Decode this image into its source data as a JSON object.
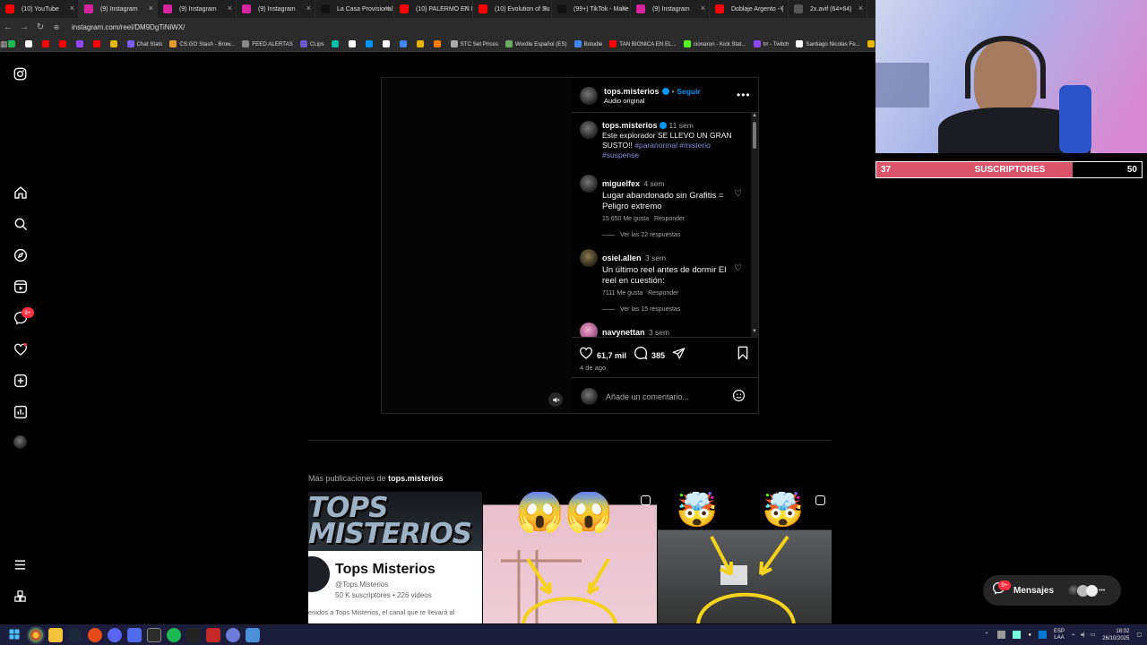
{
  "browser": {
    "tabs": [
      {
        "title": "(10) YouTube",
        "color": "#ff0000"
      },
      {
        "title": "(9) Instagram",
        "color": "#d6249f",
        "active": true
      },
      {
        "title": "(9) Instagram",
        "color": "#d6249f"
      },
      {
        "title": "(9) Instagram",
        "color": "#d6249f"
      },
      {
        "title": "La Casa Provisional",
        "color": "#111111"
      },
      {
        "title": "(10) PALERMO EN L",
        "color": "#ff0000"
      },
      {
        "title": "(10) Evolution of Su",
        "color": "#ff0000"
      },
      {
        "title": "(99+) TikTok - Make",
        "color": "#111111"
      },
      {
        "title": "(9) Instagram",
        "color": "#d6249f"
      },
      {
        "title": "Doblaje Argento - (",
        "color": "#ff0000"
      },
      {
        "title": "2x.avif (64×64)",
        "color": "#555555"
      }
    ],
    "url": "instagram.com/reel/DM9DgTiNiWX/",
    "bookmarks": [
      {
        "label": "",
        "color": "#1db954"
      },
      {
        "label": "",
        "color": "#ffffff"
      },
      {
        "label": "",
        "color": "#ff0000"
      },
      {
        "label": "",
        "color": "#ff0000"
      },
      {
        "label": "",
        "color": "#9146ff"
      },
      {
        "label": "",
        "color": "#ff0000"
      },
      {
        "label": "",
        "color": "#e8b500"
      },
      {
        "label": "Chat Stats",
        "color": "#7b5cff"
      },
      {
        "label": "CS:GO Stash - Brow...",
        "color": "#e89b2c"
      },
      {
        "label": "FEED ALERTAS",
        "color": "#888888"
      },
      {
        "label": "CLips",
        "color": "#6a5acd"
      },
      {
        "label": "",
        "color": "#00bfa5"
      },
      {
        "label": "",
        "color": "#ffffff"
      },
      {
        "label": "",
        "color": "#0095f6"
      },
      {
        "label": "",
        "color": "#ffffff"
      },
      {
        "label": "",
        "color": "#4285f4"
      },
      {
        "label": "",
        "color": "#e8b500"
      },
      {
        "label": "",
        "color": "#ff7a00"
      },
      {
        "label": "STC Set Prices",
        "color": "#aaaaaa"
      },
      {
        "label": "Wordle Español (ES)",
        "color": "#6aaa64"
      },
      {
        "label": "Boludle",
        "color": "#4285f4"
      },
      {
        "label": "TAN BIONICA EN EL...",
        "color": "#ff0000"
      },
      {
        "label": "cionaron - Kick Stat...",
        "color": "#53fc18"
      },
      {
        "label": "trr - Twitch",
        "color": "#9146ff"
      },
      {
        "label": "Santiago Nicolas Fe...",
        "color": "#ffffff"
      },
      {
        "label": "Ta",
        "color": "#e8b500"
      }
    ]
  },
  "post": {
    "username": "tops.misterios",
    "follow": "Seguir",
    "audio": "Audio original",
    "caption_age": "11 sem",
    "caption_text": "Este explorador SE LLEVO UN GRAN SUSTO!!",
    "hashtags": [
      "#paranormal",
      "#misterio",
      "#suspense"
    ],
    "comments": [
      {
        "user": "miguelfex",
        "age": "4 sem",
        "text": "Lugar abandonado sin Grafitis = Peligro extremo",
        "likes": "15 650 Me gusta",
        "reply": "Responder",
        "replies": "Ver las 22 respuestas"
      },
      {
        "user": "osiel.allen",
        "age": "3 sem",
        "text": "Un último reel antes de dormir El reel en cuestión:",
        "likes": "7111 Me gusta",
        "reply": "Responder",
        "replies": "Ver las 15 respuestas"
      },
      {
        "user": "navynettan",
        "age": "3 sem"
      }
    ],
    "like_count": "61,7 mil",
    "comment_count": "385",
    "date": "4 de ago.",
    "comment_placeholder": "Añade un comentario..."
  },
  "more": {
    "prefix": "Más publicaciones de",
    "user": "tops.misterios",
    "channel_banner": "TOPS MISTERIOS",
    "channel_name": "Tops Misterios",
    "channel_handle": "@Tops.Misterios",
    "channel_stats": "50 K suscriptores • 226 videos",
    "channel_desc": "enidos a Tops Misterios, el canal que te llevará al"
  },
  "sidebar": {
    "notif_badge": "9+"
  },
  "stream": {
    "sub_current": "37",
    "sub_label": "SUSCRIPTORES",
    "sub_goal": "50",
    "sub_progress": 0.74
  },
  "messages": {
    "label": "Mensajes",
    "badge": "9+"
  },
  "taskbar": {
    "lang": "ESP",
    "region": "LAA",
    "time": "18:02",
    "date": "26/10/2025"
  },
  "colors": {
    "accent": "#0095f6",
    "sub_fill": "#d9546b",
    "taskbar": "#1c1d3a"
  }
}
